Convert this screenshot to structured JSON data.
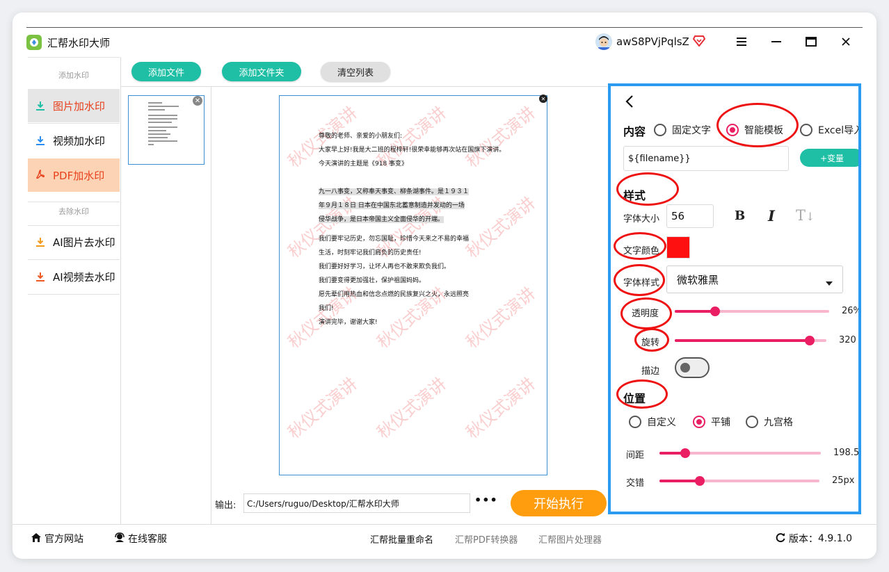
{
  "app": {
    "title": "汇帮水印大师",
    "username": "awS8PVjPqlsZ",
    "accent": "#1fbfa5"
  },
  "window_controls": {
    "menu_icon": "hamburger-menu-icon",
    "minimize_icon": "minimize-icon",
    "maximize_icon": "maximize-icon",
    "close_icon": "close-icon"
  },
  "sidebar": {
    "section_add": "添加水印",
    "section_remove": "去除水印",
    "items": [
      {
        "label": "图片加水印",
        "icon": "image-watermark-icon"
      },
      {
        "label": "视频加水印",
        "icon": "video-watermark-icon"
      },
      {
        "label": "PDF加水印",
        "icon": "pdf-icon"
      },
      {
        "label": "AI图片去水印",
        "icon": "ai-image-remove-icon"
      },
      {
        "label": "AI视频去水印",
        "icon": "ai-video-remove-icon"
      }
    ]
  },
  "toolbar": {
    "add_file": "添加文件",
    "add_folder": "添加文件夹",
    "clear_list": "清空列表"
  },
  "document": {
    "lines": [
      "尊敬的老师、亲爱的小朋友们:",
      "大家早上好!我是大二班的程梓轩!很荣幸能够再次站在国旗下演讲。",
      "今天演讲的主题是《918 事变》"
    ],
    "highlight_lines": [
      "九一八事变，又称奉天事变、柳条湖事件。是１９３１",
      "年９月１８日 日本在中国东北蓄意制造并发动的一场",
      "侵华战争，是日本帝国主义全面侵华的开端。"
    ],
    "body_lines": [
      "我们要牢记历史，勿忘国耻，珍惜今天来之不易的幸福",
      "生活，时刻牢记我们肩负的历史责任!",
      "我们要好好学习，让坏人再也不敢来欺负我们。",
      "我们要变得更加强壮，保护祖国妈妈。",
      "愿先辈们用热血和信念点燃的民族复兴之火，永远照亮",
      "我们!",
      "演讲完毕，谢谢大家!"
    ],
    "watermark_text": "秋仪式演讲",
    "watermark_color": "#ec5050"
  },
  "output": {
    "label": "输出:",
    "path": "C:/Users/ruguo/Desktop/汇帮水印大师",
    "more": "•••",
    "start": "开始执行"
  },
  "panel": {
    "back_icon": "chevron-left-icon",
    "content_heading": "内容",
    "content_options": [
      "固定文字",
      "智能模板",
      "Excel导入"
    ],
    "content_selected": "智能模板",
    "template_value": "${filename}}",
    "add_variable": "+变量",
    "style_heading": "样式",
    "font_size_label": "字体大小",
    "font_size_value": "56",
    "bold": "B",
    "italic": "I",
    "strike": "T",
    "text_color_label": "文字颜色",
    "text_color": "#ff1010",
    "font_style_label": "字体样式",
    "font_style_value": "微软雅黑",
    "opacity_label": "透明度",
    "opacity_value": "26%",
    "opacity_fraction": 0.26,
    "rotation_label": "旋转",
    "rotation_value": "320",
    "rotation_fraction": 0.89,
    "stroke_label": "描边",
    "position_heading": "位置",
    "position_options": [
      "自定义",
      "平铺",
      "九宫格"
    ],
    "position_selected": "平铺",
    "spacing_label": "间距",
    "spacing_value": "198.5",
    "spacing_fraction": 0.16,
    "stagger_label": "交错",
    "stagger_value": "25px",
    "stagger_fraction": 0.25
  },
  "footer": {
    "website": "官方网站",
    "service": "在线客服",
    "rename": "汇帮批量重命名",
    "pdf_converter": "汇帮PDF转换器",
    "image_processor": "汇帮图片处理器",
    "version_label": "版本：",
    "version": "4.9.1.0"
  }
}
